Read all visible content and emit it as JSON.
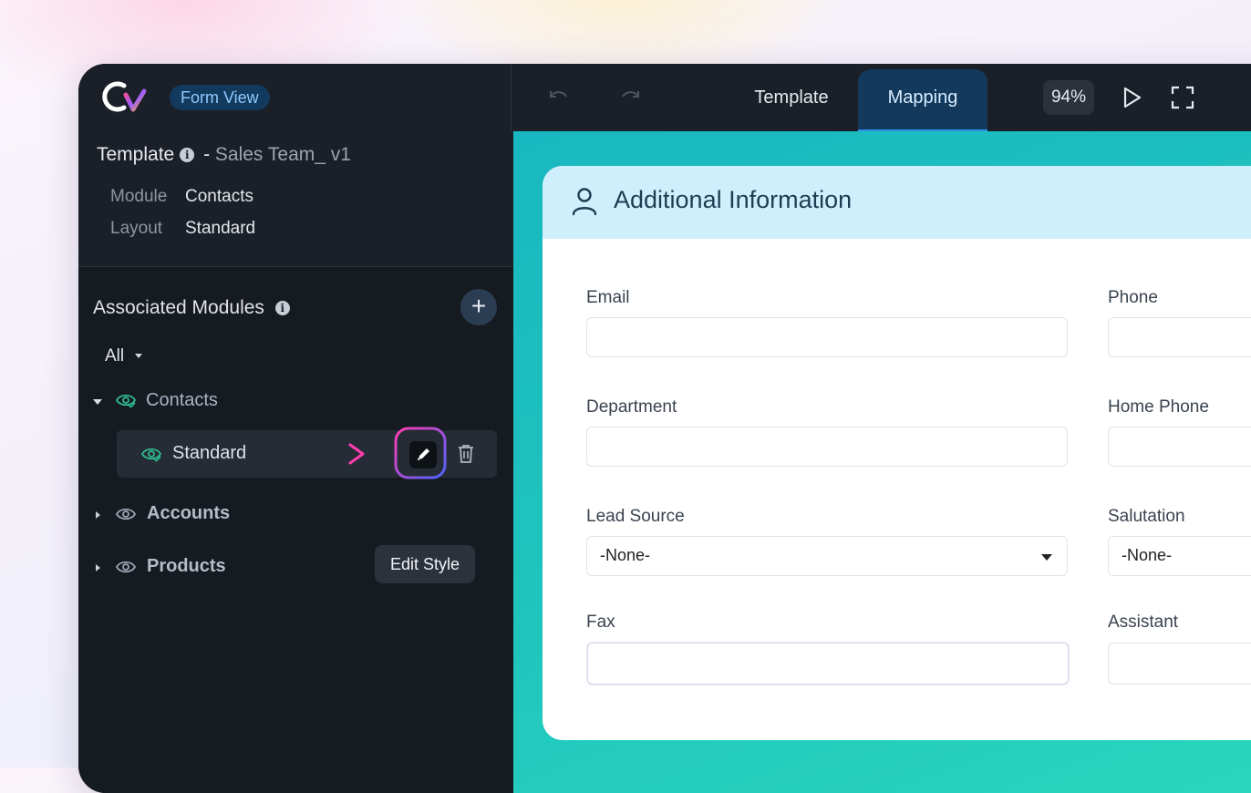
{
  "colors": {
    "accent": "#2d8fe8",
    "sidebar_bg": "#161b21",
    "canvas_teal": "#1fc4be",
    "highlight_pink": "#e93bb6",
    "eye_green": "#2fb990"
  },
  "header": {
    "badge": "Form View",
    "tabs": [
      {
        "label": "Template"
      },
      {
        "label": "Mapping",
        "active": true
      }
    ],
    "zoom": "94%",
    "icons": [
      "undo-icon",
      "redo-icon",
      "play-icon",
      "fullscreen-icon"
    ]
  },
  "template_info": {
    "label": "Template",
    "separator": "-",
    "name": "Sales Team_ v1",
    "module_key": "Module",
    "module_value": "Contacts",
    "layout_key": "Layout",
    "layout_value": "Standard"
  },
  "associated_modules": {
    "title": "Associated Modules",
    "filter": "All",
    "items": [
      {
        "label": "Contacts",
        "expanded": true,
        "children": [
          {
            "label": "Standard"
          }
        ]
      },
      {
        "label": "Accounts",
        "expanded": false
      },
      {
        "label": "Products",
        "expanded": false
      }
    ],
    "tooltip": "Edit Style"
  },
  "form": {
    "section_title": "Additional Information",
    "fields": [
      {
        "label": "Email"
      },
      {
        "label": "Phone"
      },
      {
        "label": "Department"
      },
      {
        "label": "Home Phone"
      },
      {
        "label": "Lead Source",
        "value": "-None-"
      },
      {
        "label": "Salutation",
        "value": "-None-"
      },
      {
        "label": "Fax"
      },
      {
        "label": "Assistant"
      }
    ]
  }
}
